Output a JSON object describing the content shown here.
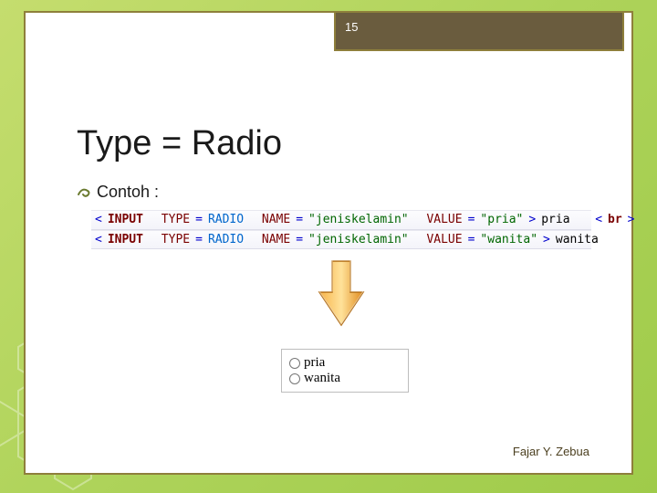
{
  "page_number": "15",
  "title": "Type = Radio",
  "bullet_label": "Contoh :",
  "code": {
    "line1": {
      "lt": "<",
      "tag": "INPUT",
      "attr1_name": "TYPE",
      "eq": "=",
      "attr1_val": "RADIO",
      "attr2_name": "NAME",
      "attr2_val": "\"jeniskelamin\"",
      "attr3_name": "VALUE",
      "attr3_val": "\"pria\"",
      "gt": ">",
      "text": "pria",
      "sp": "  ",
      "br_lt": "<",
      "br_tag": "br",
      "br_gt": ">"
    },
    "line2": {
      "lt": "<",
      "tag": "INPUT",
      "attr1_name": "TYPE",
      "eq": "=",
      "attr1_val": "RADIO",
      "attr2_name": "NAME",
      "attr2_val": "\"jeniskelamin\"",
      "attr3_name": "VALUE",
      "attr3_val": "\"wanita\"",
      "gt": ">",
      "text": "wanita"
    }
  },
  "result": {
    "option1": "pria",
    "option2": "wanita"
  },
  "footer": "Fajar Y. Zebua",
  "colors": {
    "badge_bg": "#6a5c3e",
    "frame_border": "#8e7f3b"
  }
}
